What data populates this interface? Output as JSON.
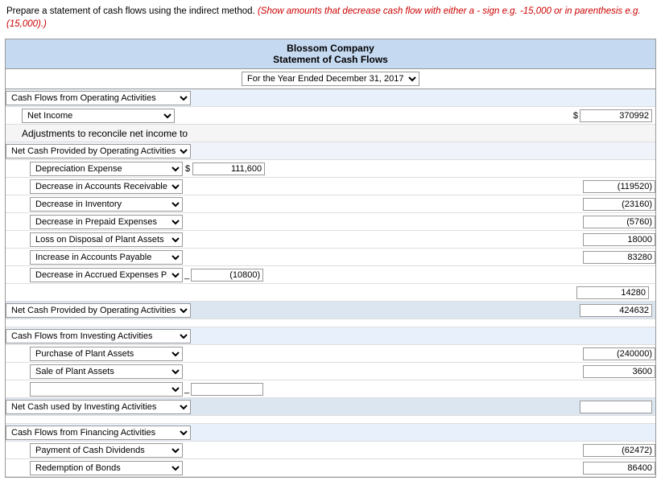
{
  "instruction": {
    "text": "Prepare a statement of cash flows using the indirect method.",
    "italic_text": "(Show amounts that decrease cash flow with either a - sign e.g. -15,000 or in parenthesis e.g. (15,000).)"
  },
  "header": {
    "company": "Blossom Company",
    "title": "Statement of Cash Flows",
    "period_label": "For the Year Ended December 31, 2017"
  },
  "sections": {
    "operating": {
      "label": "Cash Flows from Operating Activities",
      "net_income_label": "Net Income",
      "net_income_value": "370992",
      "adjustments_label": "Adjustments to reconcile net income to",
      "net_cash_label": "Net Cash Provided by Operating Activities",
      "items": [
        {
          "label": "Depreciation Expense",
          "amount": "111,600"
        },
        {
          "label": "Decrease in Accounts Receivable",
          "amount": "(119520)"
        },
        {
          "label": "Decrease in Inventory",
          "amount": "(23160)"
        },
        {
          "label": "Decrease in Prepaid Expenses",
          "amount": "(5760)"
        },
        {
          "label": "Loss on Disposal of Plant Assets",
          "amount": "18000"
        },
        {
          "label": "Increase in Accounts Payable",
          "amount": "83280"
        },
        {
          "label": "Decrease in Accrued Expenses Payable",
          "amount": "(10800)"
        }
      ],
      "subtotal": "14280",
      "total": "424632"
    },
    "investing": {
      "label": "Cash Flows from Investing Activities",
      "items": [
        {
          "label": "Purchase of Plant Assets",
          "amount": "(240000)"
        },
        {
          "label": "Sale of Plant Assets",
          "amount": "3600"
        },
        {
          "label": "",
          "amount": ""
        }
      ],
      "net_label": "Net Cash used by Investing Activities",
      "total": ""
    },
    "financing": {
      "label": "Cash Flows from Financing Activities",
      "items": [
        {
          "label": "Payment of Cash Dividends",
          "amount": "(62472)"
        },
        {
          "label": "Redemption of Bonds",
          "amount": "86400"
        }
      ]
    }
  },
  "icons": {
    "dropdown": "▾"
  }
}
